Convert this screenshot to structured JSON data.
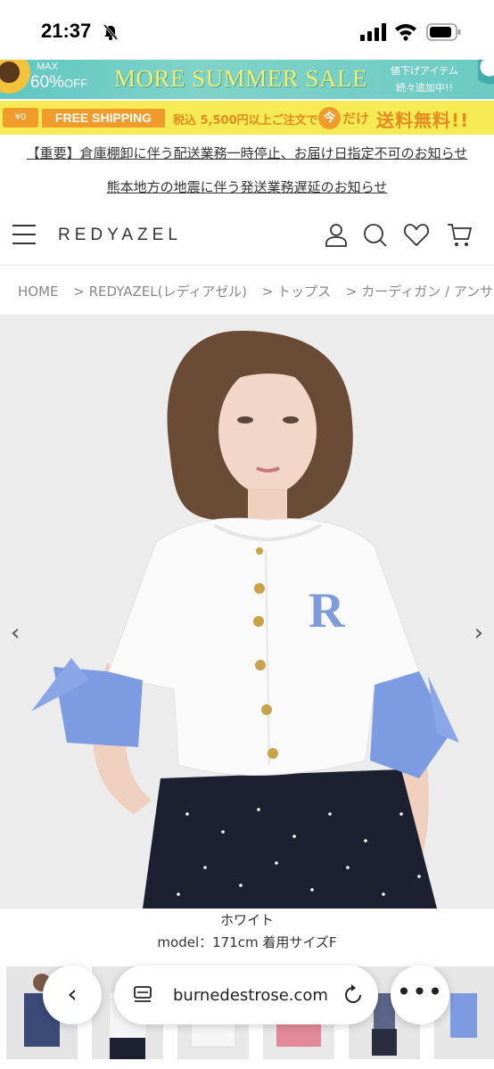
{
  "status_bar": {
    "time": "21:37"
  },
  "sale_banner": {
    "max": "MAX",
    "percent": "60%",
    "off": "OFF",
    "title": "MORE SUMMER SALE",
    "note_line1": "値下げアイテム",
    "note_line2": "続々追加中!!"
  },
  "shipping_banner": {
    "yen_badge": "¥0",
    "badge": "FREE SHIPPING",
    "condition": "税込 5,500円以上ご注文で",
    "coin": "今",
    "dake": "だけ",
    "free": "送料無料!!"
  },
  "notices": [
    "【重要】倉庫棚卸に伴う配送業務一時停止、お届け日指定不可のお知らせ",
    "熊本地方の地震に伴う発送業務遅延のお知らせ"
  ],
  "header": {
    "logo": "REDYAZEL"
  },
  "breadcrumb": {
    "items": [
      "HOME",
      "> REDYAZEL(レディアゼル)",
      "> トップス",
      "> カーディガン / アンサ"
    ]
  },
  "product": {
    "color_name": "ホワイト",
    "model_info": "model：171cm 着用サイズF"
  },
  "browser": {
    "url": "burnedestrose.com"
  },
  "colors": {
    "sale_bg": "#6ccac3",
    "sale_title": "#f8ec6e",
    "shipping_bg": "#f7eb55",
    "shipping_accent": "#f19c2a"
  }
}
